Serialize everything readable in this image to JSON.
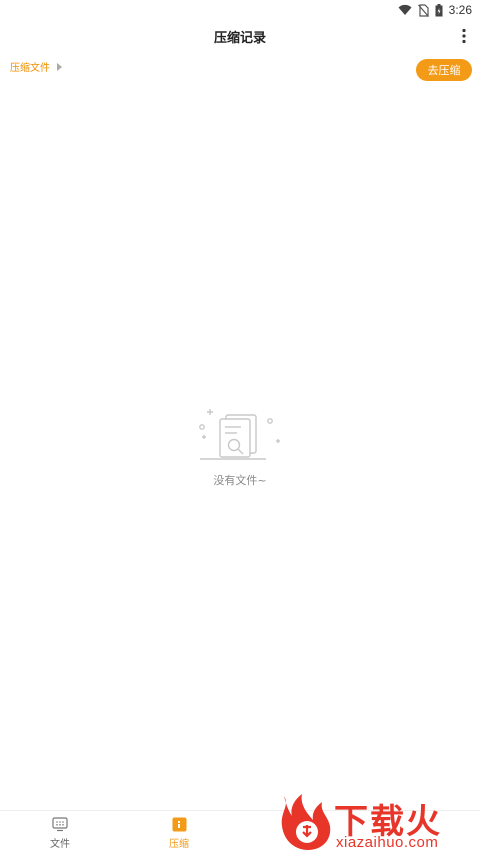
{
  "status_bar": {
    "time": "3:26",
    "icons": [
      "wifi-icon",
      "no-sim-icon",
      "battery-icon"
    ]
  },
  "header": {
    "title": "压缩记录",
    "menu_icon": "more-vert-icon"
  },
  "breadcrumb": {
    "label": "压缩文件"
  },
  "actions": {
    "go_compress_label": "去压缩"
  },
  "empty_state": {
    "icon": "empty-files-icon",
    "message": "没有文件~"
  },
  "bottom_nav": {
    "items": [
      {
        "label": "文件",
        "icon": "files-icon",
        "active": false
      },
      {
        "label": "压缩",
        "icon": "compress-icon",
        "active": true
      }
    ]
  },
  "watermark": {
    "text": "下载火",
    "url": "xiazaihuo.com"
  },
  "colors": {
    "accent": "#f39a16",
    "breadcrumb": "#f09000",
    "watermark": "#e8352a"
  }
}
